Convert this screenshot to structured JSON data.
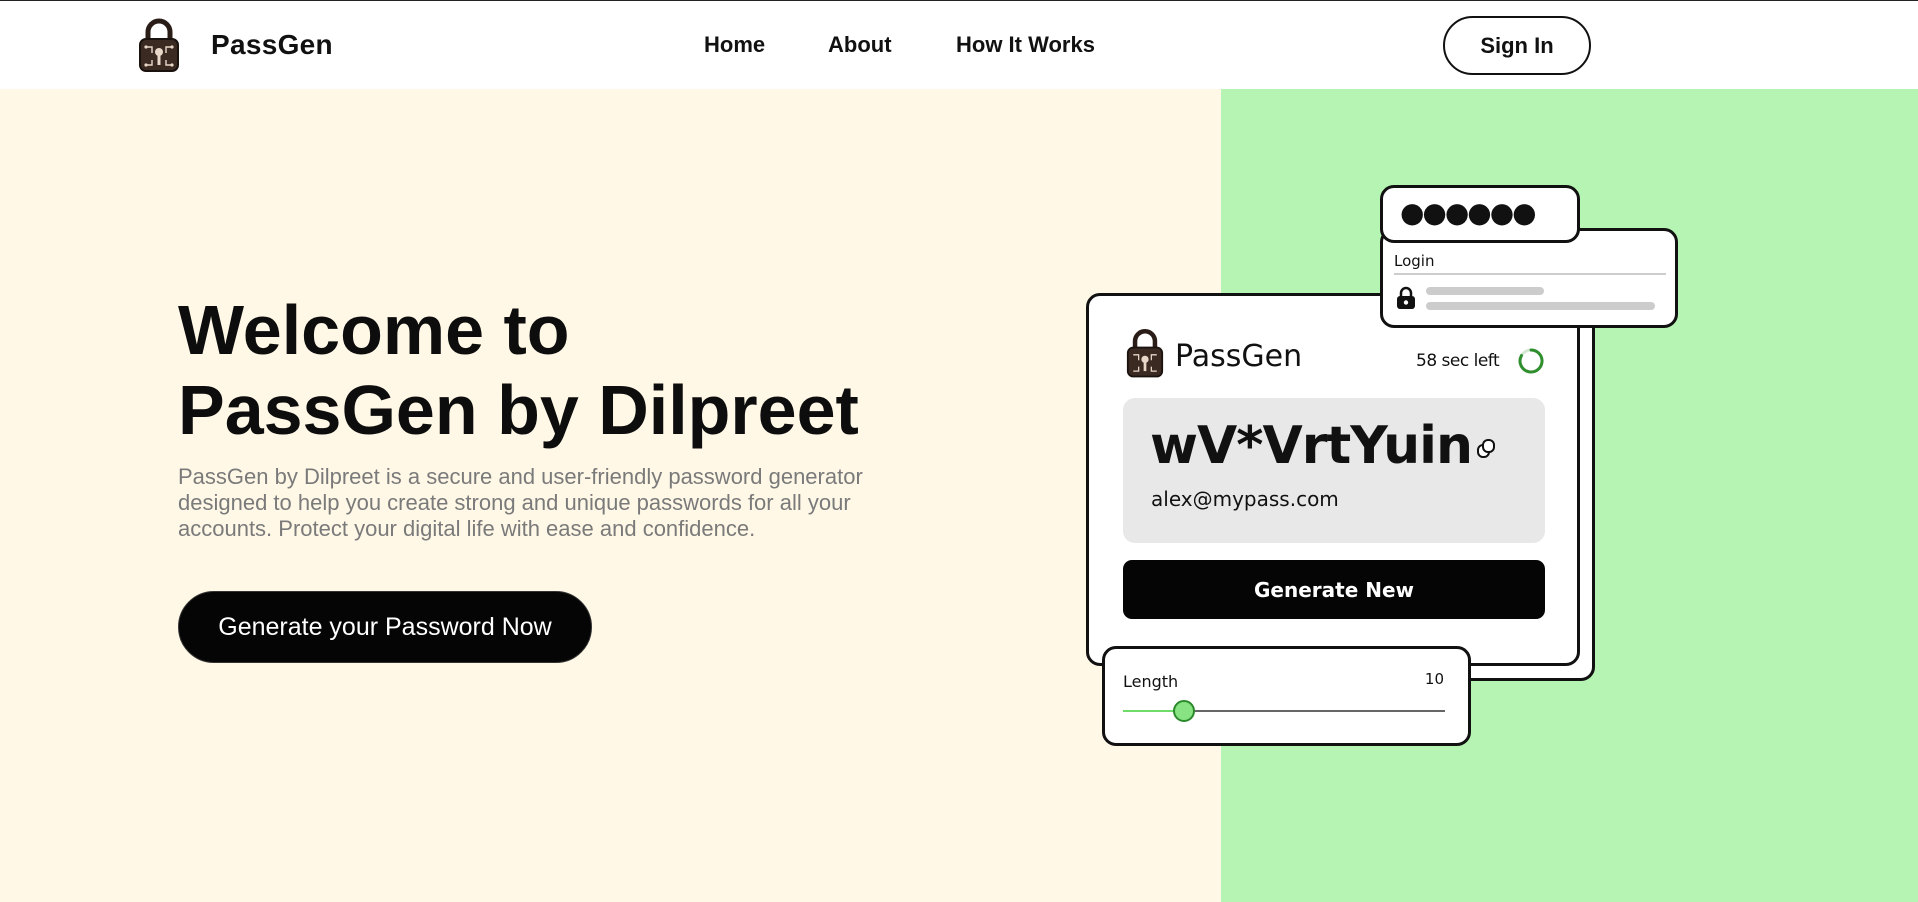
{
  "header": {
    "brand": "PassGen",
    "nav": [
      "Home",
      "About",
      "How It Works"
    ],
    "signin_label": "Sign In"
  },
  "hero": {
    "title_line1": "Welcome to",
    "title_line2": "PassGen by Dilpreet",
    "description": "PassGen by Dilpreet is a secure and user-friendly password generator designed to help you create strong and unique passwords for all your accounts. Protect your digital life with ease and confidence.",
    "cta_label": "Generate your Password Now"
  },
  "illustration": {
    "card_brand": "PassGen",
    "timer_text": "58 sec left",
    "password": "wV*VrtYuin",
    "email": "alex@mypass.com",
    "generate_label": "Generate New",
    "length_label": "Length",
    "length_value": "10",
    "length_slider_fraction": 0.19,
    "login_label": "Login",
    "masked_dots": "●●●●●●"
  },
  "colors": {
    "hero_left_bg": "#fff8e7",
    "hero_right_bg": "#b6f4b3",
    "accent_green": "#6fdc6a"
  },
  "icons": {
    "logo": "padlock-circuit-logo",
    "copy": "copy-icon",
    "lock": "lock-icon",
    "timer": "timer-ring-icon"
  }
}
